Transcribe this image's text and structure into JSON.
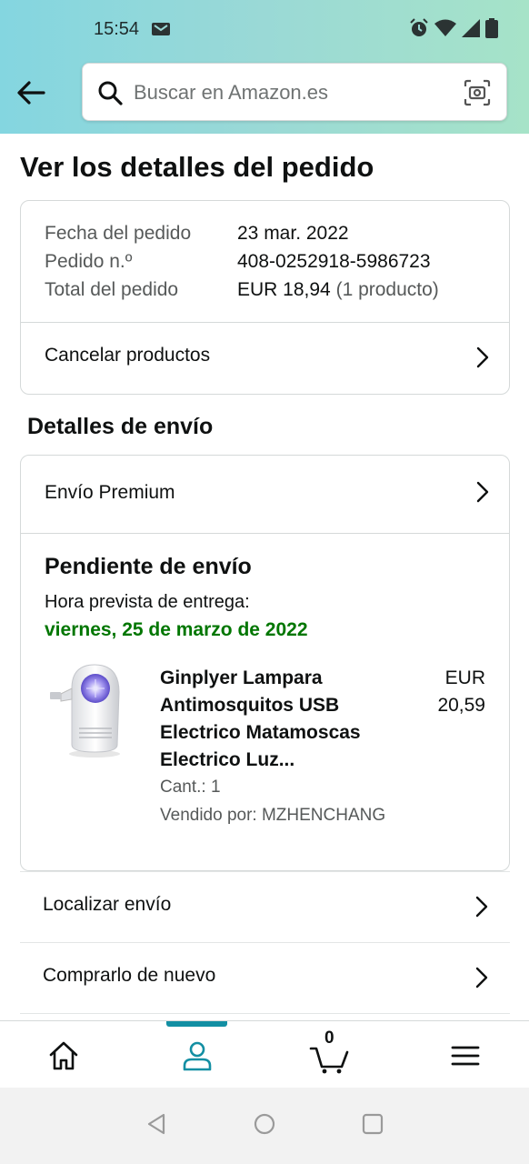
{
  "status_bar": {
    "time": "15:54"
  },
  "search": {
    "placeholder": "Buscar en Amazon.es"
  },
  "page": {
    "title": "Ver los detalles del pedido"
  },
  "order_summary": {
    "rows": [
      {
        "label": "Fecha del pedido",
        "value": "23 mar. 2022"
      },
      {
        "label": "Pedido n.º",
        "value": "408-0252918-5986723"
      },
      {
        "label": "Total del pedido",
        "value": "EUR 18,94",
        "suffix": "(1 producto)"
      }
    ],
    "cancel_label": "Cancelar productos"
  },
  "shipping": {
    "section_title": "Detalles de envío",
    "shipping_type": "Envío Premium",
    "status": "Pendiente de envío",
    "eta_label": "Hora prevista de entrega:",
    "eta_date": "viernes, 25 de marzo de 2022",
    "product": {
      "name": "Ginplyer Lampara Antimosquitos USB Electrico Matamoscas Electrico Luz...",
      "price_currency": "EUR",
      "price_value": "20,59",
      "quantity": "Cant.: 1",
      "seller": "Vendido por: MZHENCHANG"
    }
  },
  "actions": {
    "track": "Localizar envío",
    "buy_again": "Comprarlo de nuevo"
  },
  "bottom_nav": {
    "cart_count": "0",
    "active_tab": "account",
    "accent_color": "#138fa3"
  },
  "colors": {
    "eta_green": "#007600",
    "header_gradient_start": "#84d6e0",
    "header_gradient_end": "#a6e3c8"
  }
}
